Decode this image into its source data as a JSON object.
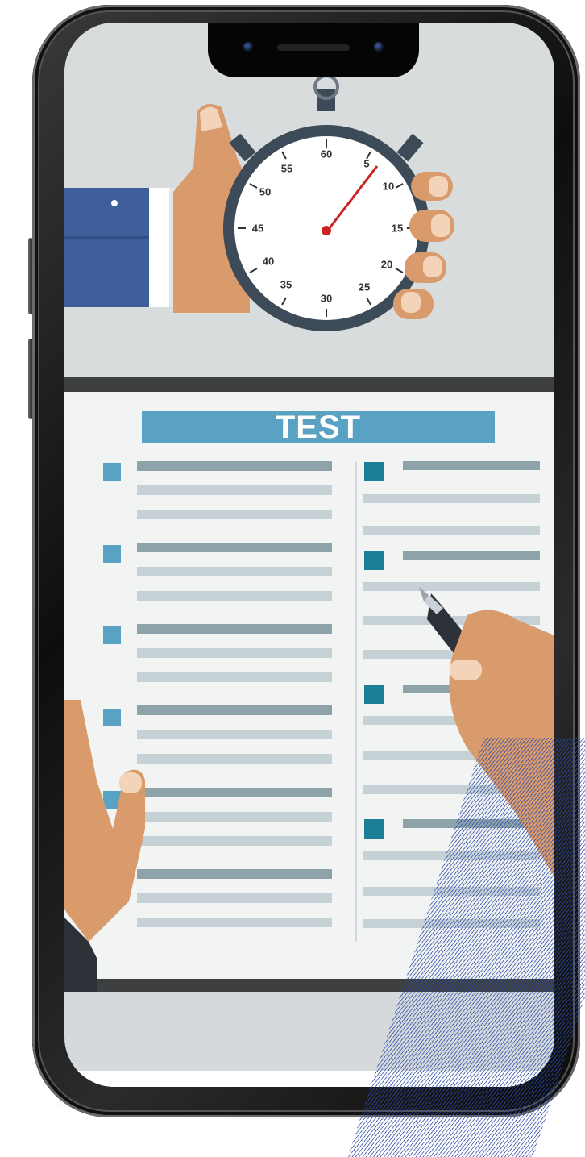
{
  "test_sheet": {
    "title": "TEST"
  },
  "stopwatch": {
    "dial_numbers": [
      "60",
      "5",
      "10",
      "15",
      "20",
      "25",
      "30",
      "35",
      "40",
      "45",
      "50",
      "55"
    ]
  },
  "colors": {
    "sheet_header": "#5aa2c4",
    "checkbox_left": "#5aa2c4",
    "checkbox_right": "#1d7e98",
    "sleeve": "#3f5f9c",
    "skin": "#d99a6c"
  }
}
